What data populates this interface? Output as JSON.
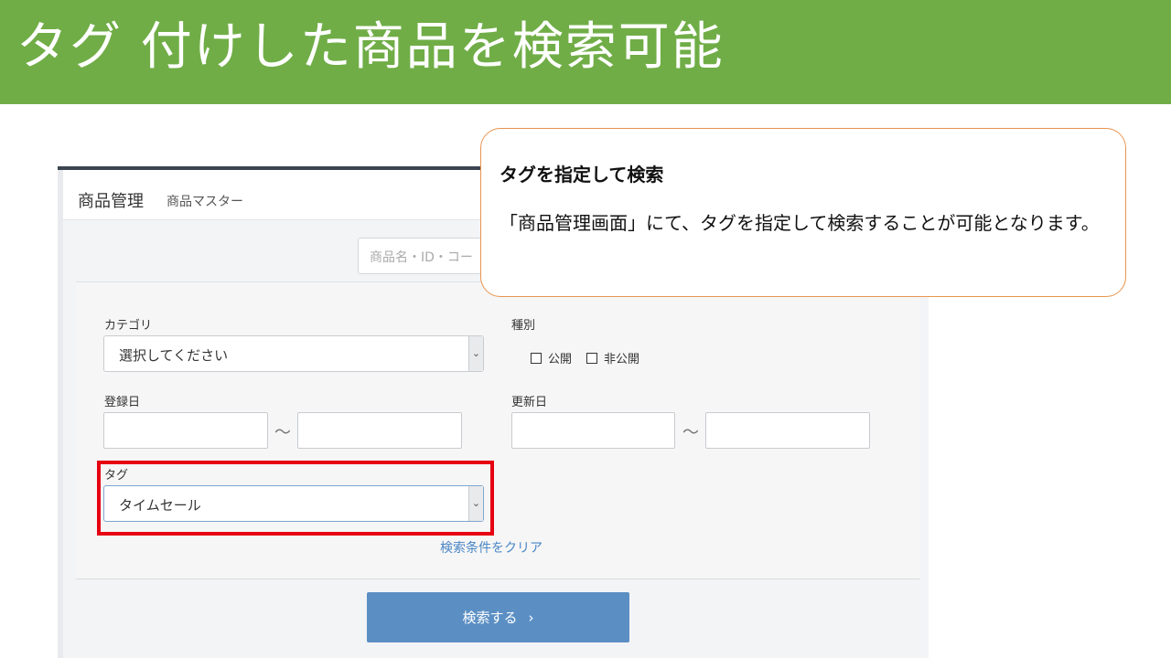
{
  "slide": {
    "title": "タグ 付けした商品を検索可能"
  },
  "screenshot": {
    "header": {
      "title": "商品管理",
      "subtitle": "商品マスター"
    },
    "search": {
      "placeholder": "商品名・ID・コー"
    },
    "filters": {
      "category_label": "カテゴリ",
      "category_value": "選択してください",
      "type_label": "種別",
      "type_options": [
        "公開",
        "非公開"
      ],
      "registered_label": "登録日",
      "updated_label": "更新日",
      "range_separator": "～",
      "tag_label": "タグ",
      "tag_value": "タイムセール",
      "clear_link": "検索条件をクリア"
    },
    "search_button": {
      "label": "検索する",
      "icon": "chevron-right-icon"
    }
  },
  "callout": {
    "heading": "タグを指定して検索",
    "body": "「商品管理画面」にて、タグを指定して検索することが可能となります。"
  },
  "colors": {
    "banner": "#70ad47",
    "highlight": "#e60012",
    "callout_border": "#e8944f",
    "button": "#5b8fc4",
    "link": "#4a86c5"
  }
}
